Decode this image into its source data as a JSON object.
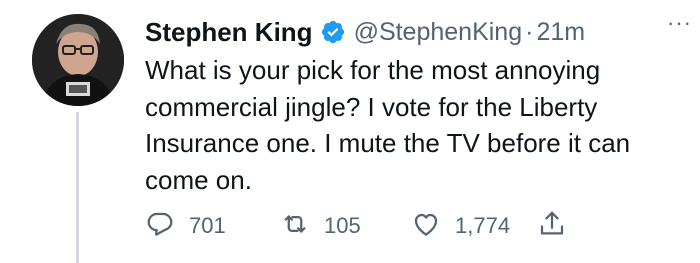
{
  "tweet": {
    "author_name": "Stephen King",
    "handle": "@StephenKing",
    "separator": "·",
    "time": "21m",
    "more_label": "···",
    "text": "What is your pick for the most annoying\ncommercial jingle? I vote for the Liberty\nInsurance one. I mute the TV before it can\ncome on.",
    "replies": "701",
    "retweets": "105",
    "likes": "1,774"
  },
  "colors": {
    "text": "#0f1419",
    "secondary": "#536471",
    "verified": "#1d9bf0",
    "thread_line": "#cfd9de"
  },
  "icons": {
    "verified": "verified-badge-icon",
    "reply": "reply-icon",
    "retweet": "retweet-icon",
    "like": "heart-icon",
    "share": "share-icon",
    "more": "more-icon"
  }
}
